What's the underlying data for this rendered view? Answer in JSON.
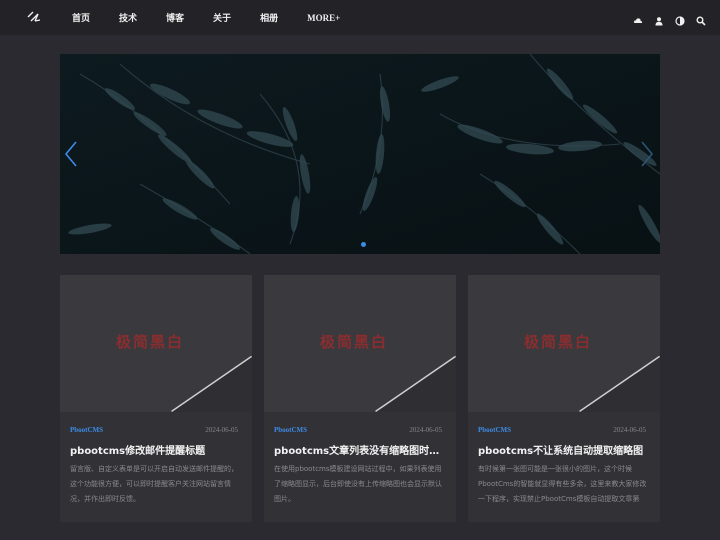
{
  "nav": {
    "items": [
      "首页",
      "技术",
      "博客",
      "关于",
      "相册",
      "MORE+"
    ]
  },
  "toolbar": {
    "icons": [
      "cloud-user-icon",
      "user-icon",
      "theme-toggle-icon",
      "search-icon"
    ]
  },
  "banner": {
    "active_slide": 1,
    "slide_count": 1
  },
  "cards": [
    {
      "category": "PbootCMS",
      "date": "2024-06-05",
      "title": "pbootcms修改邮件提醒标题",
      "excerpt": "留言版、自定义表单是可以开启自动发送邮件提醒的，这个功能很方便，可以即时提醒客户关注网站留言情况，并作出即时反馈。",
      "watermark": "极简黑白"
    },
    {
      "category": "PbootCMS",
      "date": "2024-06-05",
      "title": "pbootcms文章列表没有缩略图时也不...",
      "excerpt": "在使用pbootcms模板建设网站过程中，如果列表使用了缩略图显示，后台即使没有上传缩略图也会显示默认图片。",
      "watermark": "极简黑白"
    },
    {
      "category": "PbootCMS",
      "date": "2024-06-05",
      "title": "pbootcms不让系统自动提取缩略图",
      "excerpt": "有时候第一张图可能是一张很小的图片，这个时候PbootCms的智能就显得有些多余，这里来教大家修改一下程序，实现禁止PbootCms模板自动提取文章第",
      "watermark": "极简黑白"
    }
  ],
  "colors": {
    "accent": "#3c8ce7",
    "background": "#2b2a30",
    "header": "#232226",
    "card": "#323136"
  }
}
